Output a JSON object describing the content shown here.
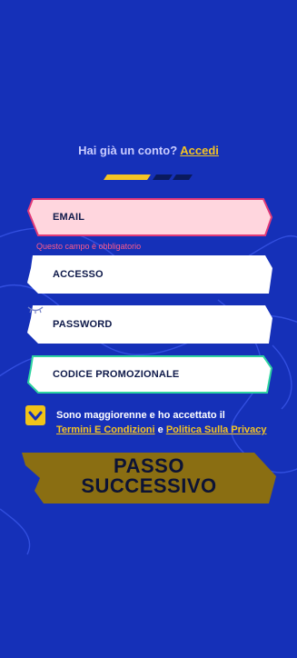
{
  "header": {
    "account_prompt": "Hai già un conto?",
    "login_link": "Accedi"
  },
  "steps": {
    "colors": [
      "#f5c423",
      "#0a1a5e",
      "#0a1a5e"
    ]
  },
  "form": {
    "email_label": "EMAIL",
    "email_error": "Questo campo è obbligatorio",
    "username_label": "ACCESSO",
    "password_label": "PASSWORD",
    "promo_label": "CODICE PROMOZIONALE"
  },
  "terms": {
    "checked": true,
    "text_before": "Sono maggiorenne e ho accettato il",
    "terms_link": "Termini E Condizioni",
    "conjunction": "e",
    "privacy_link": "Politica Sulla Privacy"
  },
  "cta": {
    "line1": "PASSO",
    "line2": "SUCCESSIVO"
  },
  "colors": {
    "background": "#1530b8",
    "accent": "#f5c423",
    "error": "#ff5b8a",
    "promo_border": "#2ed3a0",
    "email_bg": "#ffd6de",
    "button_bg": "#8a6e12"
  },
  "icons": {
    "password_toggle": "eye-closed-icon",
    "check": "check-icon"
  }
}
